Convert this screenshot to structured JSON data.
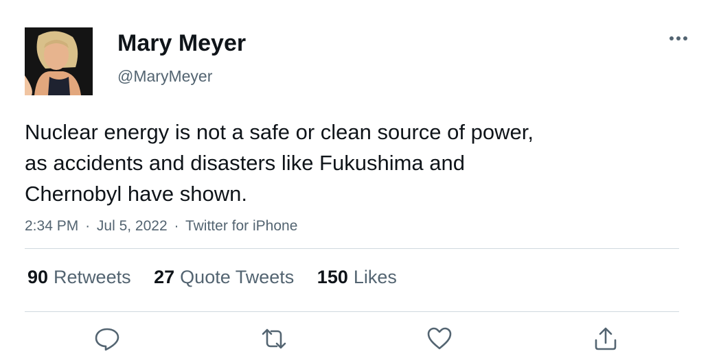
{
  "tweet": {
    "author": {
      "display_name": "Mary Meyer",
      "handle": "@MaryMeyer"
    },
    "text": "Nuclear energy is not a safe or clean source of power,\nas accidents and disasters like Fukushima and\nChernobyl have shown.",
    "time": "2:34 PM",
    "date": "Jul 5, 2022",
    "source": "Twitter for iPhone",
    "separator": "·"
  },
  "stats": {
    "retweets": {
      "count": "90",
      "label": "Retweets"
    },
    "quote_tweets": {
      "count": "27",
      "label": "Quote Tweets"
    },
    "likes": {
      "count": "150",
      "label": "Likes"
    }
  },
  "icons": {
    "more": "more-horizontal-icon",
    "reply": "reply-icon",
    "retweet": "retweet-icon",
    "like": "heart-icon",
    "share": "share-icon"
  },
  "colors": {
    "text": "#0f1419",
    "secondary": "#536471",
    "divider": "#cfd9de"
  }
}
